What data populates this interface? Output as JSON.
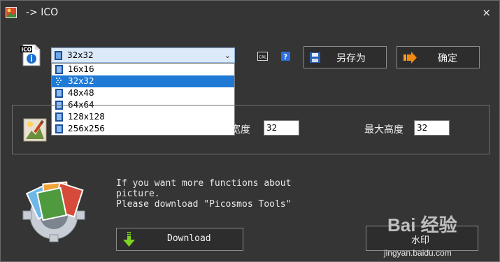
{
  "window": {
    "title": "-> ICO",
    "close": "×"
  },
  "format_select": {
    "selected": "32x32",
    "options": [
      "16x16",
      "32x32",
      "48x48",
      "64x64",
      "128x128",
      "256x256"
    ]
  },
  "toolbar": {
    "save_as": "另存为",
    "ok": "确定"
  },
  "size": {
    "width_label": "宽度",
    "width_value": "32",
    "height_label": "最大高度",
    "height_value": "32"
  },
  "promo": {
    "text": "If you want more functions about\npicture.\nPlease download \"Picosmos Tools\"",
    "download_label": "Download",
    "watermark_label": "水印"
  },
  "overlay": {
    "brand": "Bai 经验",
    "url": "jingyan.baidu.com"
  },
  "colors": {
    "selection": "#1f7ad6",
    "combo_bg": "#dbe9f8",
    "window_bg": "#353535"
  }
}
